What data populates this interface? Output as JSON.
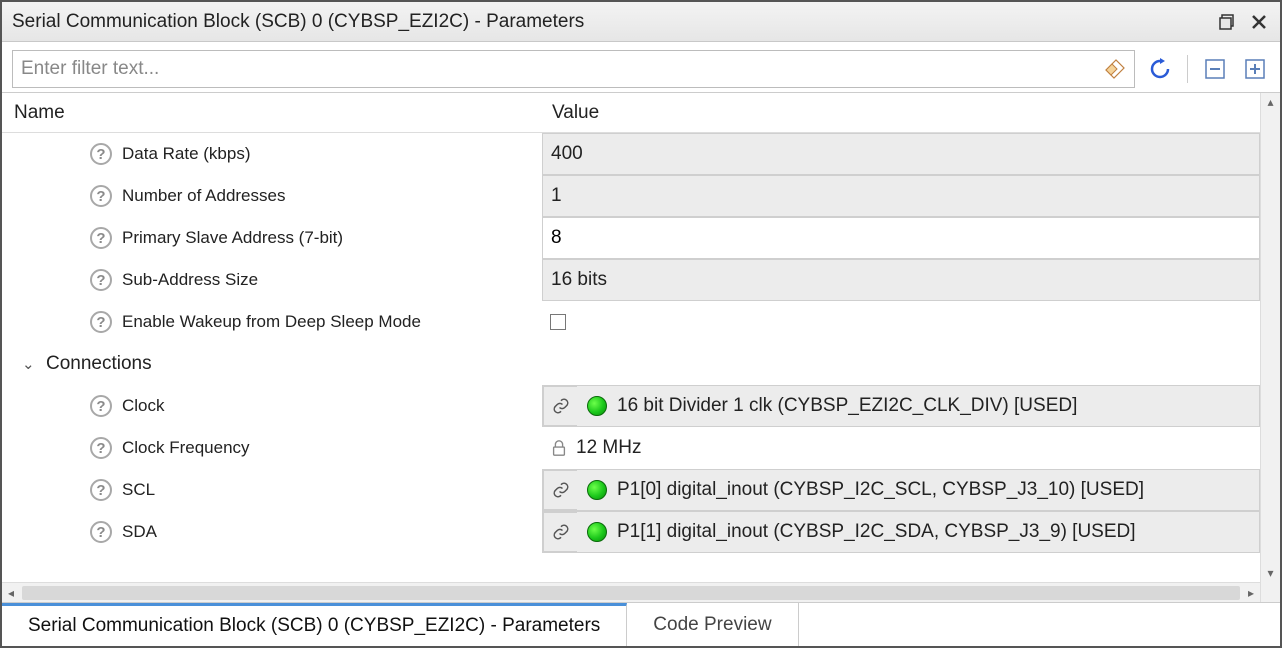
{
  "window": {
    "title": "Serial Communication Block (SCB) 0 (CYBSP_EZI2C) - Parameters"
  },
  "filter": {
    "placeholder": "Enter filter text..."
  },
  "headers": {
    "name": "Name",
    "value": "Value"
  },
  "params": [
    {
      "label": "Data Rate (kbps)",
      "value": "400",
      "style": "gray"
    },
    {
      "label": "Number of Addresses",
      "value": "1",
      "style": "gray"
    },
    {
      "label": "Primary Slave Address (7-bit)",
      "value": "8",
      "style": "white",
      "editable": true
    },
    {
      "label": "Sub-Address Size",
      "value": "16 bits",
      "style": "gray"
    },
    {
      "label": "Enable Wakeup from Deep Sleep Mode",
      "value": "",
      "style": "plain",
      "checkbox": true,
      "checked": false
    }
  ],
  "group": {
    "label": "Connections",
    "expanded": true
  },
  "connections": [
    {
      "label": "Clock",
      "value": "16 bit Divider 1 clk (CYBSP_EZI2C_CLK_DIV) [USED]",
      "style": "gray",
      "link": true,
      "status": "green"
    },
    {
      "label": "Clock Frequency",
      "value": "12 MHz",
      "style": "plain",
      "lock": true
    },
    {
      "label": "SCL",
      "value": "P1[0] digital_inout (CYBSP_I2C_SCL, CYBSP_J3_10) [USED]",
      "style": "gray",
      "link": true,
      "status": "green"
    },
    {
      "label": "SDA",
      "value": "P1[1] digital_inout (CYBSP_I2C_SDA, CYBSP_J3_9) [USED]",
      "style": "gray",
      "link": true,
      "status": "green"
    }
  ],
  "tabs": {
    "active": "Serial Communication Block (SCB) 0 (CYBSP_EZI2C) - Parameters",
    "other": "Code Preview"
  }
}
